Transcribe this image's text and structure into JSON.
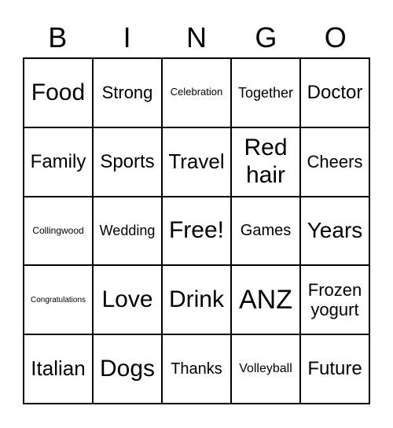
{
  "header": [
    "B",
    "I",
    "N",
    "G",
    "O"
  ],
  "cells": [
    [
      "Food",
      "Strong",
      "Celebration",
      "Together",
      "Doctor"
    ],
    [
      "Family",
      "Sports",
      "Travel",
      "Red hair",
      "Cheers"
    ],
    [
      "Collingwood",
      "Wedding",
      "Free!",
      "Games",
      "Years"
    ],
    [
      "Congratulations",
      "Love",
      "Drink",
      "ANZ",
      "Frozen yogurt"
    ],
    [
      "Italian",
      "Dogs",
      "Thanks",
      "Volleyball",
      "Future"
    ]
  ]
}
